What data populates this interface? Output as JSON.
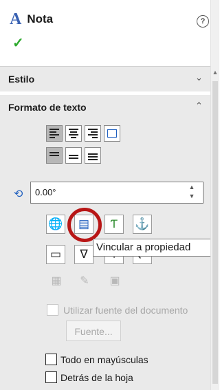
{
  "header": {
    "icon_glyph": "A",
    "title": "Nota",
    "help_glyph": "?",
    "ok_glyph": "✓"
  },
  "sections": {
    "style": {
      "label": "Estilo",
      "chevron": "⌄"
    },
    "text_format": {
      "label": "Formato de texto",
      "chevron": "⌃"
    }
  },
  "angle": {
    "value": "0.00°",
    "icon_glyph": "⟲",
    "spin_up": "▲",
    "spin_down": "▼"
  },
  "toolbar_row1_icons": [
    "globe-link-icon",
    "link-property-icon",
    "insert-field-icon",
    "anchor-icon"
  ],
  "icons": {
    "globe": "🌐",
    "link_property": "▤",
    "insert_field": "Ƭ",
    "anchor": "⚓",
    "frame": "▭",
    "symbol": "∇",
    "stack": "⊤",
    "extra": "⇄",
    "dis1": "▦",
    "dis2": "✎",
    "dis3": "▣"
  },
  "tooltip": {
    "text": "Vincular a propiedad"
  },
  "doc_font": {
    "label": "Utilizar fuente del documento",
    "checked": false,
    "enabled": false
  },
  "font_button": {
    "label": "Fuente...",
    "enabled": false
  },
  "all_caps": {
    "label": "Todo en mayúsculas",
    "checked": false
  },
  "behind_sheet": {
    "label": "Detrás de la hoja",
    "checked": false
  },
  "colors": {
    "accent": "#3b63b3",
    "highlight_ring": "#b81616",
    "ok": "#2eaa2e"
  }
}
